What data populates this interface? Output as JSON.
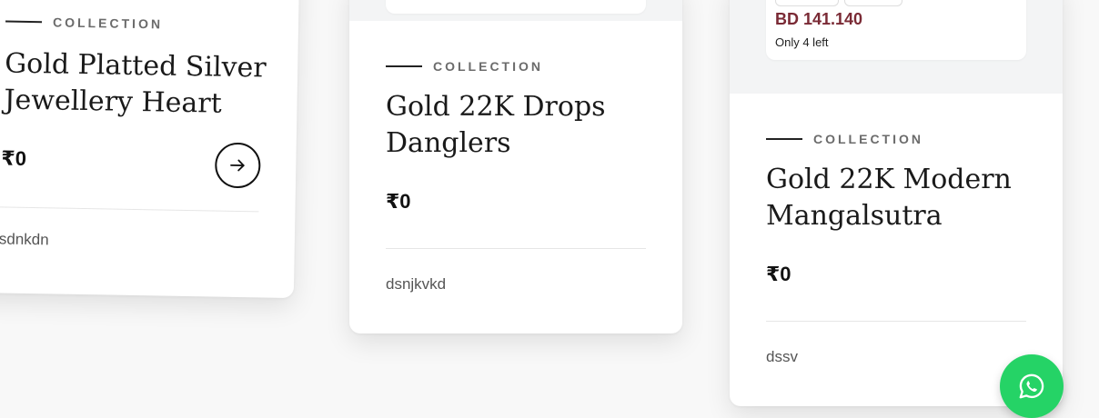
{
  "cards": [
    {
      "eyebrow": "COLLECTION",
      "title_line1": "Gold Platted Silver",
      "title_line2": "Jewellery Heart",
      "price": "₹0",
      "description": "sdnkdn"
    },
    {
      "eyebrow": "COLLECTION",
      "title_line1": "Gold 22K Drops",
      "title_line2": "Danglers",
      "price": "₹0",
      "description": "dsnjkvkd"
    },
    {
      "eyebrow": "COLLECTION",
      "title_line1": "Gold 22K Modern",
      "title_line2": "Mangalsutra",
      "price": "₹0",
      "description": "dssv",
      "preview_price": "BD 141.140",
      "preview_stock": "Only 4 left"
    }
  ],
  "icons": {
    "arrow": "arrow-right-icon",
    "whatsapp": "whatsapp-icon"
  },
  "colors": {
    "whatsapp_green": "#25d366",
    "bd_price": "#7a2a35"
  }
}
